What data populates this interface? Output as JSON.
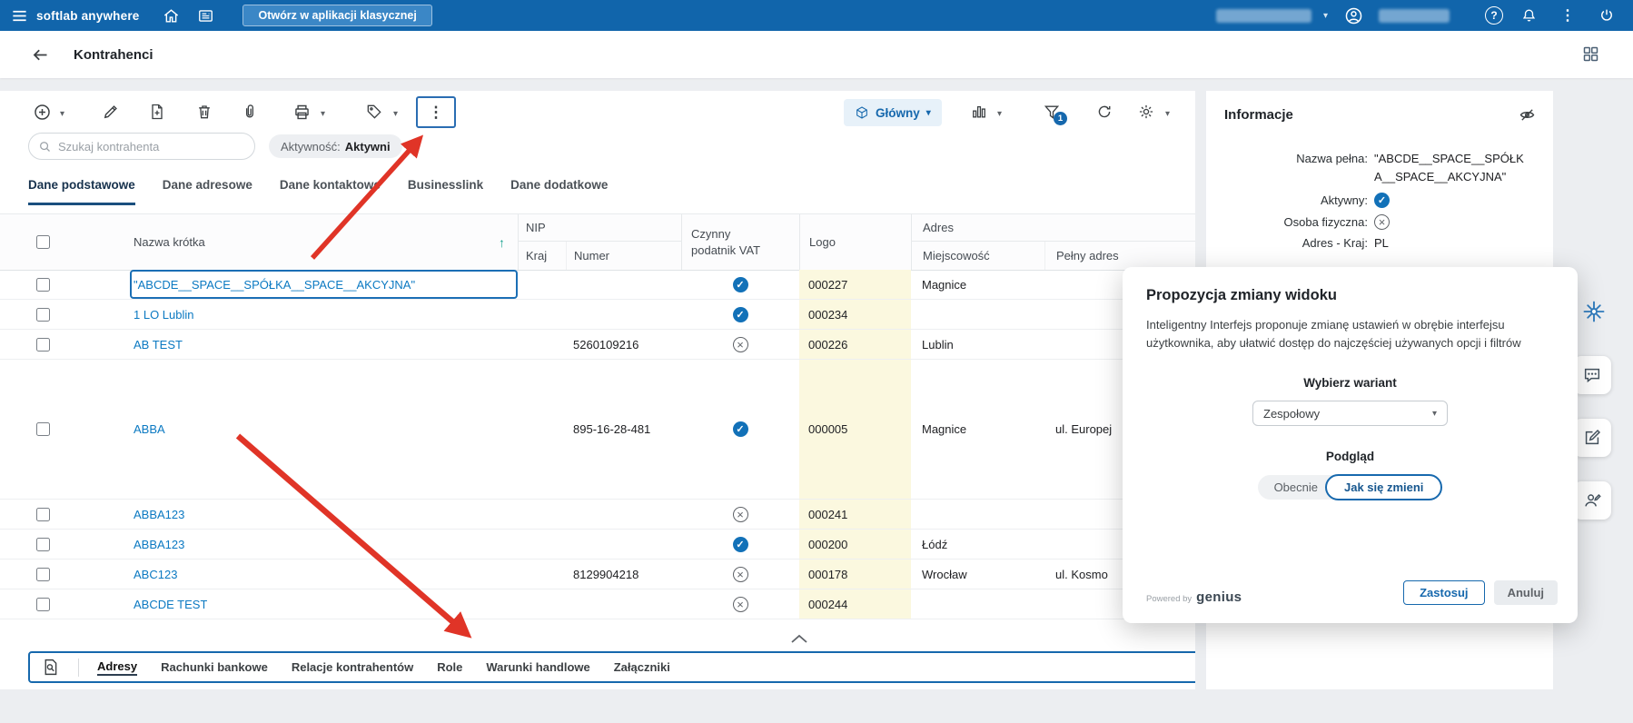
{
  "topbar": {
    "app_name": "softlab anywhere",
    "open_classic_label": "Otwórz w aplikacji klasycznej"
  },
  "titlebar": {
    "title": "Kontrahenci"
  },
  "toolbar": {
    "view_label": "Główny",
    "filter_count": "1"
  },
  "filters": {
    "search_placeholder": "Szukaj kontrahenta",
    "activity_label": "Aktywność:",
    "activity_value": "Aktywni"
  },
  "tabs": {
    "items": [
      {
        "label": "Dane podstawowe",
        "active": true
      },
      {
        "label": "Dane adresowe",
        "active": false
      },
      {
        "label": "Dane kontaktowe",
        "active": false
      },
      {
        "label": "Businesslink",
        "active": false
      },
      {
        "label": "Dane dodatkowe",
        "active": false
      }
    ]
  },
  "table": {
    "headers": {
      "name": "Nazwa krótka",
      "nip": "NIP",
      "kraj": "Kraj",
      "numer": "Numer",
      "czynny": "Czynny",
      "podatnik_vat": "podatnik VAT",
      "logo": "Logo",
      "adres": "Adres",
      "miejscowosc": "Miejscowość",
      "pelny_adres": "Pełny adres"
    },
    "sort_column": "Nazwa krótka",
    "sort_direction": "asc",
    "rows": [
      {
        "name": "\"ABCDE__SPACE__SPÓŁKA__SPACE__AKCYJNA\"",
        "kraj": "",
        "numer": "",
        "vat_active": true,
        "logo": "000227",
        "miejscowosc": "Magnice",
        "pelny_adres": ""
      },
      {
        "name": "1 LO Lublin",
        "kraj": "",
        "numer": "",
        "vat_active": true,
        "logo": "000234",
        "miejscowosc": "",
        "pelny_adres": ""
      },
      {
        "name": "AB TEST",
        "kraj": "",
        "numer": "5260109216",
        "vat_active": false,
        "logo": "000226",
        "miejscowosc": "Lublin",
        "pelny_adres": ""
      },
      {
        "name": "ABBA",
        "kraj": "",
        "numer": "895-16-28-481",
        "vat_active": true,
        "logo": "000005",
        "miejscowosc": "Magnice",
        "pelny_adres": "ul. Europej"
      },
      {
        "name": "ABBA123",
        "kraj": "",
        "numer": "",
        "vat_active": false,
        "logo": "000241",
        "miejscowosc": "",
        "pelny_adres": ""
      },
      {
        "name": "ABBA123",
        "kraj": "",
        "numer": "",
        "vat_active": true,
        "logo": "000200",
        "miejscowosc": "Łódź",
        "pelny_adres": ""
      },
      {
        "name": "ABC123",
        "kraj": "",
        "numer": "8129904218",
        "vat_active": false,
        "logo": "000178",
        "miejscowosc": "Wrocław",
        "pelny_adres": "ul. Kosmo"
      },
      {
        "name": "ABCDE TEST",
        "kraj": "",
        "numer": "",
        "vat_active": false,
        "logo": "000244",
        "miejscowosc": "",
        "pelny_adres": ""
      }
    ]
  },
  "bottombar": {
    "items": [
      {
        "label": "Adresy",
        "active": true
      },
      {
        "label": "Rachunki bankowe",
        "active": false
      },
      {
        "label": "Relacje kontrahentów",
        "active": false
      },
      {
        "label": "Role",
        "active": false
      },
      {
        "label": "Warunki handlowe",
        "active": false
      },
      {
        "label": "Załączniki",
        "active": false
      }
    ]
  },
  "info_panel": {
    "title": "Informacje",
    "name_label": "Nazwa pełna:",
    "name_value": "\"ABCDE__SPACE__SPÓŁKA__SPACE__AKCYJNA\"",
    "active_label": "Aktywny:",
    "active_value": true,
    "physical_label": "Osoba fizyczna:",
    "physical_value": false,
    "country_label": "Adres - Kraj:",
    "country_value": "PL"
  },
  "dialog": {
    "title": "Propozycja zmiany widoku",
    "body": "Inteligentny Interfejs proponuje zmianę ustawień w obrębie interfejsu użytkownika, aby ułatwić dostęp do najczęściej używanych opcji i filtrów",
    "variant_label": "Wybierz wariant",
    "variant_value": "Zespołowy",
    "preview_label": "Podgląd",
    "segment_current": "Obecnie",
    "segment_changed": "Jak się zmieni",
    "powered_by": "Powered by",
    "brand": "genius",
    "apply_label": "Zastosuj",
    "cancel_label": "Anuluj"
  },
  "colors": {
    "topbar": "#1165ab",
    "accent": "#1668ad",
    "link": "#0b79c2",
    "logo_column_bg": "#fbf8df",
    "annotation_arrow": "#e03427",
    "check": "#1271b8"
  },
  "icons": {
    "toolbar": [
      "add-icon",
      "edit-icon",
      "add-document-icon",
      "delete-icon",
      "attachment-icon",
      "print-icon",
      "tag-icon",
      "more-vertical-icon",
      "view-cube-icon",
      "chart-icon",
      "filter-icon",
      "refresh-icon",
      "settings-icon"
    ],
    "right_rail": [
      "ai-sparkle-icon",
      "chat-icon",
      "edit-note-icon",
      "contact-icon"
    ]
  }
}
